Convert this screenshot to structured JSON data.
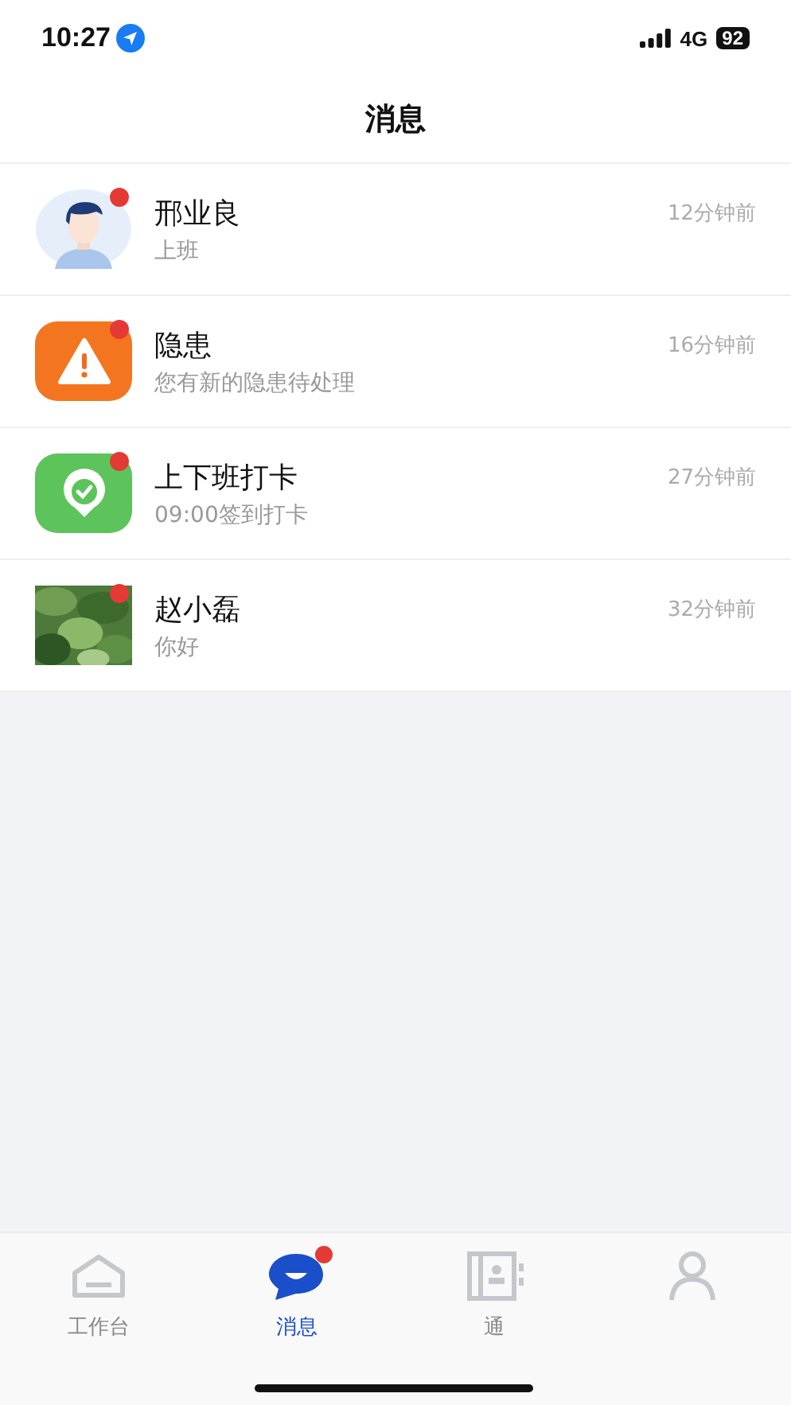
{
  "status_bar": {
    "time": "10:27",
    "network": "4G",
    "battery": "92"
  },
  "header": {
    "title": "消息"
  },
  "messages": [
    {
      "kind": "person",
      "name": "邢业良",
      "preview": "上班",
      "time": "12分钟前",
      "unread": true
    },
    {
      "kind": "warning",
      "name": "隐患",
      "preview": "您有新的隐患待处理",
      "time": "16分钟前",
      "unread": true
    },
    {
      "kind": "checkin",
      "name": "上下班打卡",
      "preview": "09:00签到打卡",
      "time": "27分钟前",
      "unread": true
    },
    {
      "kind": "picture",
      "name": "赵小磊",
      "preview": "你好",
      "time": "32分钟前",
      "unread": true
    }
  ],
  "tab_bar": [
    {
      "kind": "workbench",
      "label": "工作台",
      "selected": false,
      "badge": false
    },
    {
      "kind": "messages",
      "label": "消息",
      "selected": true,
      "badge": true
    },
    {
      "kind": "contacts",
      "label": "通",
      "selected": false,
      "badge": false
    },
    {
      "kind": "profile",
      "selected": false,
      "badge": false
    }
  ]
}
